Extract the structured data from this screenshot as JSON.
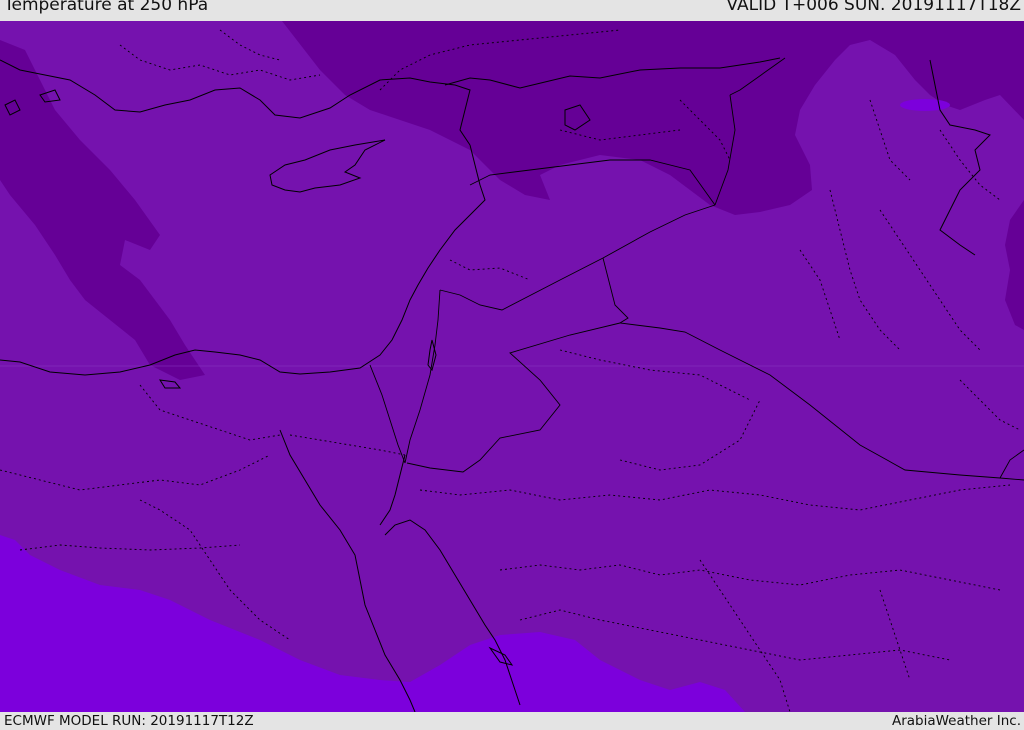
{
  "header": {
    "title": "Temperature at 250 hPa",
    "valid_time": "VALID T+006 SUN. 20191117T18Z"
  },
  "footer": {
    "model_run": "ECMWF MODEL RUN: 20191117T12Z",
    "credit": "ArabiaWeather Inc."
  },
  "colors": {
    "background_field": "#7512ae",
    "cold_band": "#650096",
    "warm_band": "#7c00dc",
    "coastline": "#000000",
    "border": "#000000"
  }
}
